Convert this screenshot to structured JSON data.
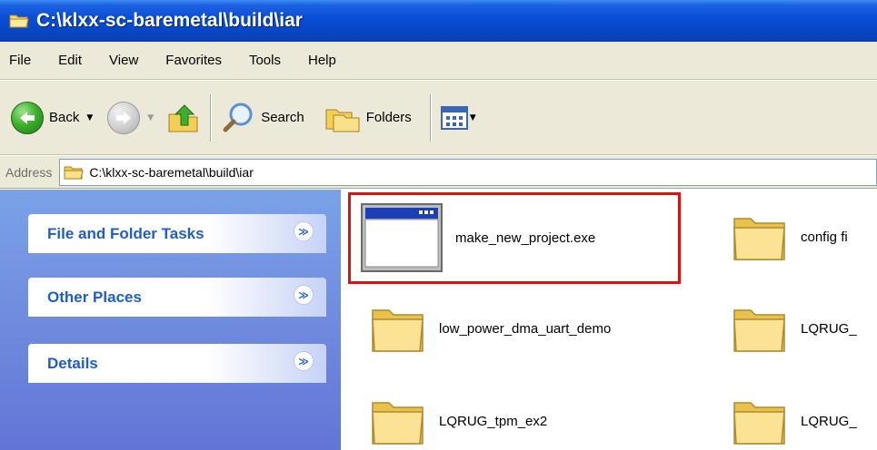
{
  "window": {
    "title": "C:\\klxx-sc-baremetal\\build\\iar"
  },
  "menu": {
    "file": "File",
    "edit": "Edit",
    "view": "View",
    "favorites": "Favorites",
    "tools": "Tools",
    "help": "Help"
  },
  "toolbar": {
    "back_label": "Back",
    "search_label": "Search",
    "folders_label": "Folders"
  },
  "address": {
    "label": "Address",
    "value": "C:\\klxx-sc-baremetal\\build\\iar"
  },
  "tasks": [
    {
      "title": "File and Folder Tasks"
    },
    {
      "title": "Other Places"
    },
    {
      "title": "Details"
    }
  ],
  "files": [
    {
      "name": "make_new_project.exe",
      "icon": "exe-window-icon"
    },
    {
      "name": "config fi",
      "icon": "folder-icon"
    },
    {
      "name": "low_power_dma_uart_demo",
      "icon": "folder-icon"
    },
    {
      "name": "LQRUG_",
      "icon": "folder-icon"
    },
    {
      "name": "LQRUG_tpm_ex2",
      "icon": "folder-icon"
    },
    {
      "name": "LQRUG_",
      "icon": "folder-icon"
    }
  ],
  "colors": {
    "titlebar": "#0a4fd6",
    "taskpane": "#7ba2e7",
    "task_title": "#215dc6",
    "highlight": "#e01010"
  }
}
